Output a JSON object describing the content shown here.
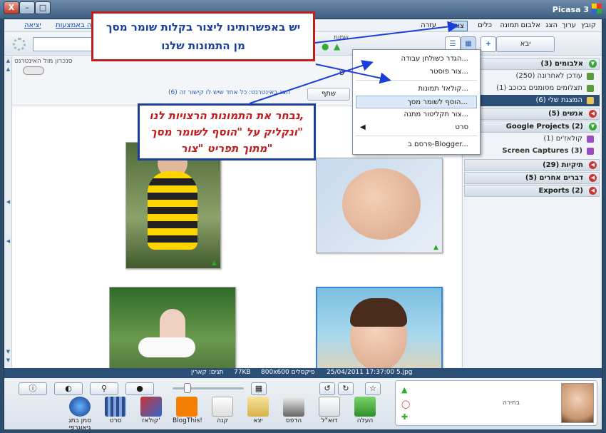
{
  "window": {
    "title": "Picasa 3",
    "min": "–",
    "max": "□",
    "close": "X"
  },
  "menu": {
    "file": "קובץ",
    "edit": "ערוך",
    "view": "הצג",
    "album": "אלבום",
    "picture": "תמונה",
    "create": "צור",
    "tools": "כלים",
    "help": "עזרה",
    "exit": "יציאה",
    "signin": "כניסה באמצעות Google"
  },
  "toolbar": {
    "import": "יבא",
    "names_label": "שמות",
    "add": "+"
  },
  "header": {
    "sync_label": "סנכרון מול האינטרנט",
    "share": "שתף",
    "share_info": "הצג באינטרנט: כל אחד שיש לו קישור זה (6)",
    "title_char": "ש"
  },
  "folders": [
    {
      "label": "אלבומים (3)",
      "type": "group",
      "open": true
    },
    {
      "label": "עודכן לאחרונה (250)",
      "type": "item"
    },
    {
      "label": "תצלומים מסומנים בכוכב (1)",
      "type": "item"
    },
    {
      "label": "המצגת שלי (6)",
      "type": "item",
      "selected": true
    },
    {
      "label": "אנשים (5)",
      "type": "group"
    },
    {
      "label": "Google Projects (2)",
      "type": "group",
      "open": true
    },
    {
      "label": "קולאז'ים (1)",
      "type": "item"
    },
    {
      "label": "Screen Captures (3)",
      "type": "item"
    },
    {
      "label": "תיקיות (29)",
      "type": "group"
    },
    {
      "label": "דברים אחרים (5)",
      "type": "group"
    },
    {
      "label": "Exports (2)",
      "type": "group"
    }
  ],
  "dropdown": [
    "הגדר כשולחן עבודה...",
    "צור פוסטר...",
    "קולאז' תמונות...",
    "הוסף לשומר מסך...",
    "צור תקליטור מתנה...",
    "סרט",
    "פרסם ב-Blogger..."
  ],
  "status": {
    "file": "5.jpg",
    "datetime": "25/04/2011 17:37:00",
    "dims": "800x600 פיקסלים",
    "size": "77KB",
    "tags": "תגים: קארין"
  },
  "bottom": {
    "selection": "בחירה",
    "actions": [
      "העלה",
      "דוא\"ל",
      "הדפס",
      "יצא",
      "קנה",
      "BlogThis!",
      "קולאז'",
      "סרט",
      "סמן בתג גיאוגרפי"
    ]
  },
  "annotations": {
    "top": [
      "יש באפשרותינו ליצור בקלות שומר מסך",
      "מן התמונות שלנו"
    ],
    "middle": [
      "נבחר את התמונות הרצויות לנו,",
      "ונקליק על \"הוסף לשומר מסך\"",
      "מתוך תפריט \"צור\""
    ]
  },
  "colors": {
    "accent": "#2c4f78",
    "annotation_red": "#c21d1d",
    "annotation_blue": "#1a3f9c"
  }
}
